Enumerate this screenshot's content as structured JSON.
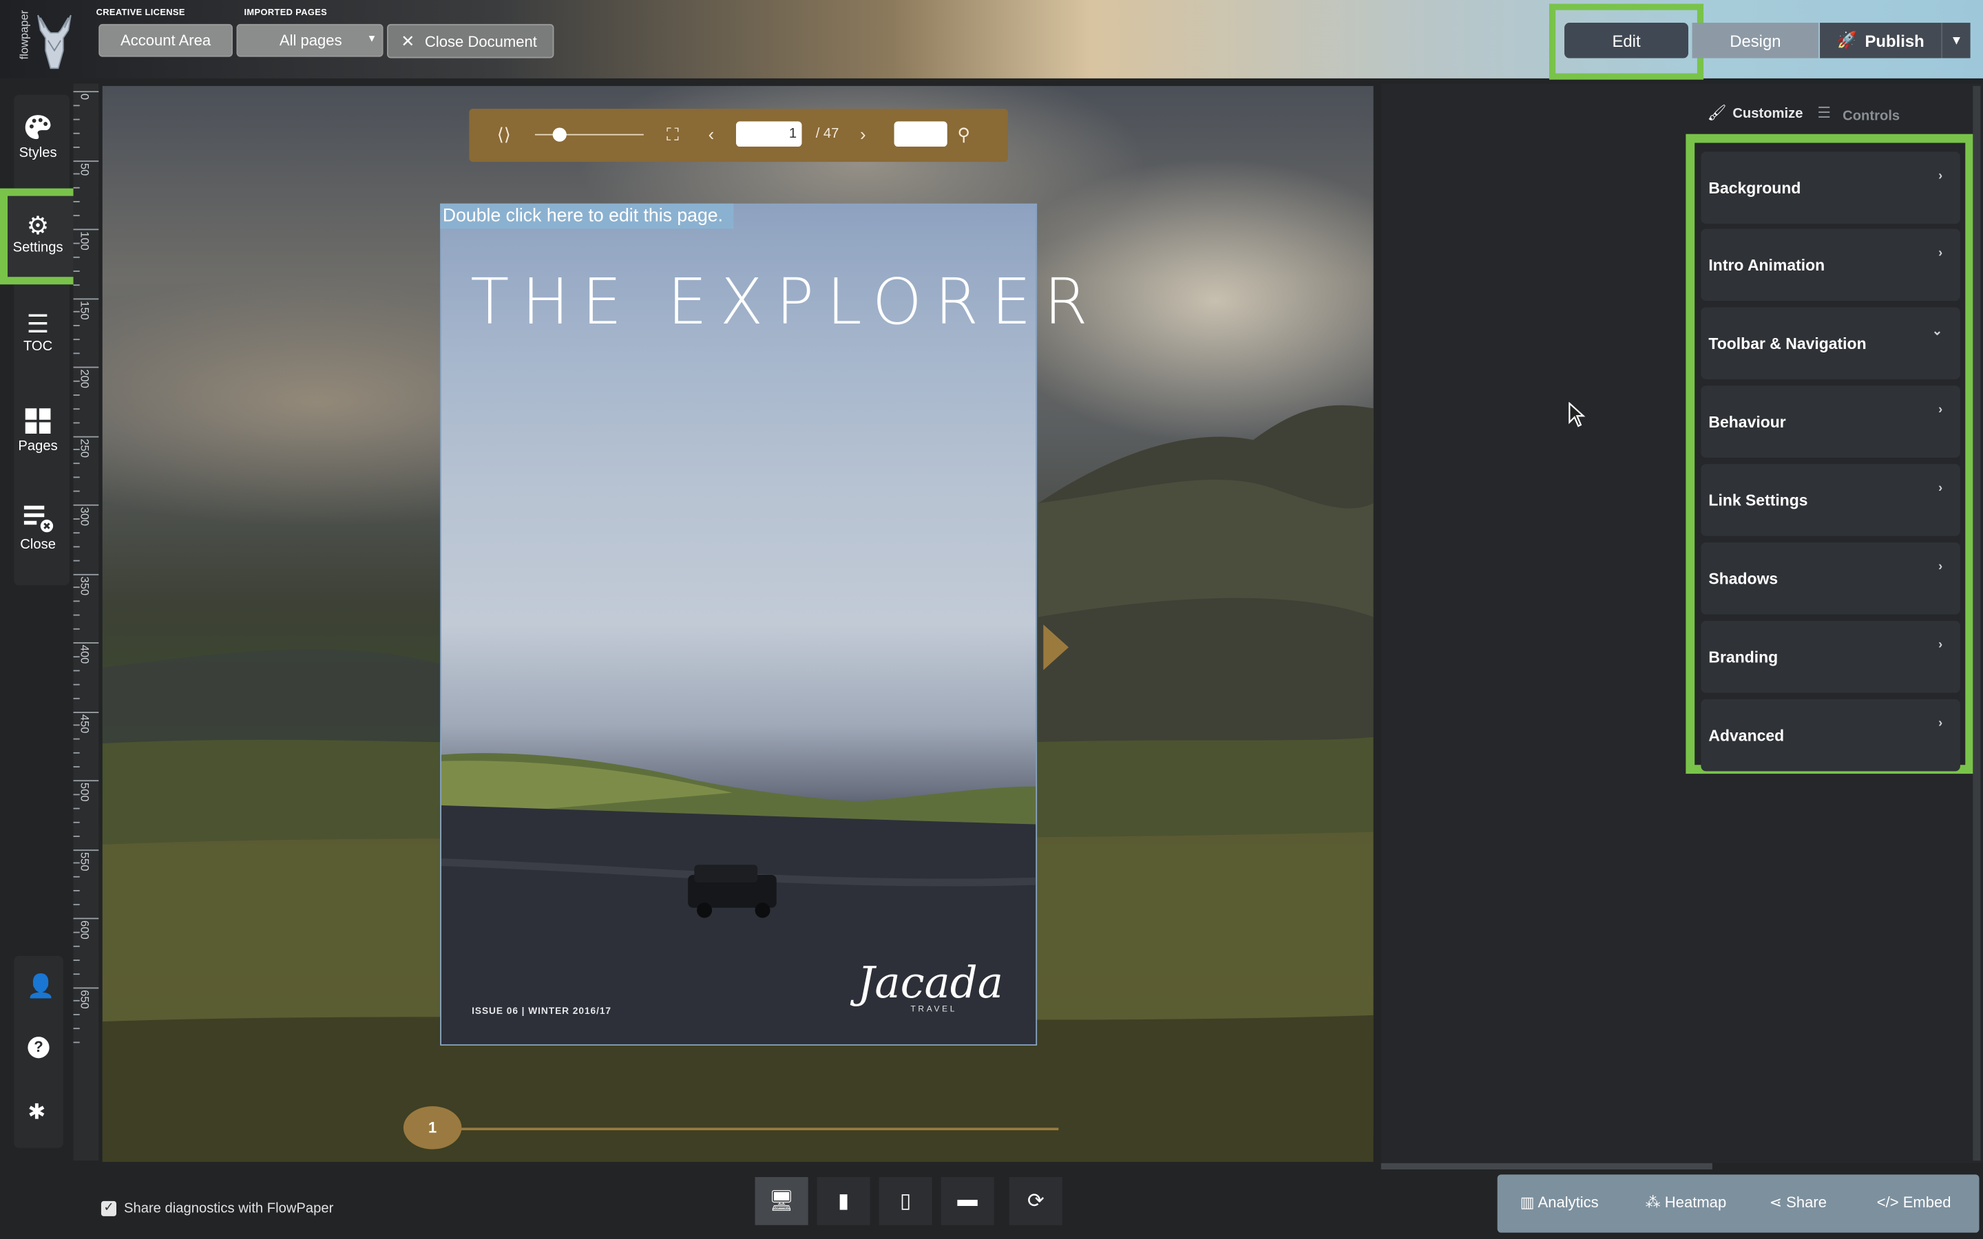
{
  "header": {
    "logo_text": "flowpaper",
    "license_label": "CREATIVE LICENSE",
    "account_button": "Account Area",
    "imported_label": "IMPORTED PAGES",
    "pages_select": "All pages",
    "close_document": "Close Document",
    "modes": {
      "edit": "Edit",
      "design": "Design",
      "publish": "Publish"
    }
  },
  "sidebar": {
    "items": [
      {
        "label": "Styles",
        "icon": "palette-icon"
      },
      {
        "label": "Settings",
        "icon": "gear-icon"
      },
      {
        "label": "TOC",
        "icon": "list-icon"
      },
      {
        "label": "Pages",
        "icon": "grid-icon"
      },
      {
        "label": "Close",
        "icon": "close-document-icon"
      }
    ],
    "bottom_icons": [
      "user-icon",
      "help-icon",
      "bug-icon"
    ]
  },
  "ruler": {
    "labels": [
      "0",
      "50",
      "100",
      "150",
      "200",
      "250",
      "300",
      "350",
      "400",
      "450",
      "500",
      "550",
      "600",
      "650"
    ]
  },
  "viewer": {
    "toolbar": {
      "page_value": "1",
      "page_total": "/ 47",
      "search_value": ""
    },
    "edit_hint": "Double click here to edit this page.",
    "cover": {
      "title": "THE EXPLORER",
      "issue": "ISSUE 06 | WINTER 2016/17",
      "brand": "Jacada",
      "brand_sub": "TRAVEL"
    },
    "pager_current": "1"
  },
  "right_panel": {
    "tabs": {
      "customize": "Customize",
      "controls": "Controls"
    },
    "sections": [
      {
        "label": "Background",
        "expanded": false
      },
      {
        "label": "Intro Animation",
        "expanded": false
      },
      {
        "label": "Toolbar & Navigation",
        "expanded": true
      },
      {
        "label": "Behaviour",
        "expanded": false
      },
      {
        "label": "Link Settings",
        "expanded": false
      },
      {
        "label": "Shadows",
        "expanded": false
      },
      {
        "label": "Branding",
        "expanded": false
      },
      {
        "label": "Advanced",
        "expanded": false
      }
    ]
  },
  "footer": {
    "diagnostics_label": "Share diagnostics with FlowPaper",
    "diagnostics_checked": true,
    "devices": [
      "desktop-icon",
      "tablet-icon",
      "phone-icon",
      "landscape-icon",
      "rotate-icon"
    ],
    "actions": {
      "analytics": "Analytics",
      "heatmap": "Heatmap",
      "share": "Share",
      "embed": "Embed"
    }
  },
  "colors": {
    "highlight": "#79c34a",
    "toolbar_gold": "#8a6a35",
    "edit_active": "#404853"
  }
}
